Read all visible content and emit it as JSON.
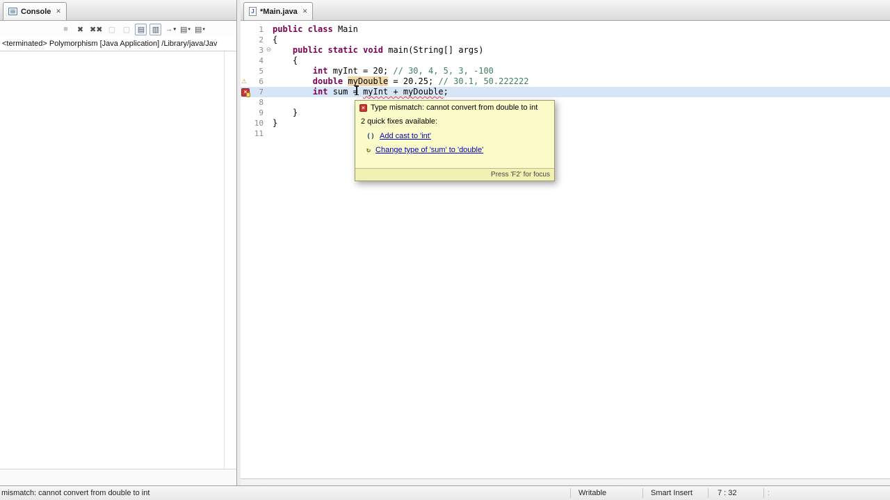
{
  "colors": {
    "keyword": "#7b0052",
    "comment": "#3f7f5f",
    "error_marker": "#cc3333",
    "link": "#0000c0",
    "tooltip_bg": "#fbfbc9",
    "current_line_highlight": "#d7e6f7",
    "occurrence_highlight": "#f1d9a9"
  },
  "console": {
    "tab_label": "Console",
    "status_line": "<terminated> Polymorphism [Java Application] /Library/java/Jav",
    "toolbar_icons": [
      {
        "name": "terminate-icon",
        "glyph": "■",
        "style": "disabled",
        "caret": false
      },
      {
        "name": "remove-launch-icon",
        "glyph": "✖",
        "style": "dark",
        "caret": false
      },
      {
        "name": "remove-all-terminated-icon",
        "glyph": "✖✖",
        "style": "dark",
        "caret": false
      },
      {
        "name": "clear-console-icon",
        "glyph": "▢",
        "style": "disabled",
        "caret": false
      },
      {
        "name": "scroll-lock-icon",
        "glyph": "▢",
        "style": "disabled",
        "caret": false
      },
      {
        "name": "show-console-on-output-icon",
        "glyph": "▤",
        "style": "framed",
        "caret": false
      },
      {
        "name": "pin-console-icon",
        "glyph": "▥",
        "style": "framed",
        "caret": false
      },
      {
        "name": "open-console-icon",
        "glyph": "→",
        "style": "green",
        "caret": true
      },
      {
        "name": "display-selected-console-icon",
        "glyph": "▤",
        "style": "dark",
        "caret": true
      },
      {
        "name": "view-menu-icon",
        "glyph": "▤",
        "style": "dark",
        "caret": true
      }
    ]
  },
  "editor": {
    "tab_label": "*Main.java",
    "tab_icon": {
      "name": "java-file-icon",
      "glyph": "J"
    },
    "code_lines": [
      {
        "n": "1",
        "segs": [
          [
            "k",
            "public"
          ],
          [
            "p",
            " "
          ],
          [
            "k",
            "class"
          ],
          [
            "p",
            " Main"
          ]
        ]
      },
      {
        "n": "2",
        "segs": [
          [
            "p",
            "{"
          ]
        ]
      },
      {
        "n": "3",
        "fold": true,
        "segs": [
          [
            "p",
            "    "
          ],
          [
            "k",
            "public"
          ],
          [
            "p",
            " "
          ],
          [
            "k",
            "static"
          ],
          [
            "p",
            " "
          ],
          [
            "k",
            "void"
          ],
          [
            "p",
            " main(String[] args)"
          ]
        ]
      },
      {
        "n": "4",
        "segs": [
          [
            "p",
            "    {"
          ]
        ]
      },
      {
        "n": "5",
        "segs": [
          [
            "p",
            "        "
          ],
          [
            "k",
            "int"
          ],
          [
            "p",
            " myInt = 20; "
          ],
          [
            "c",
            "// 30, 4, 5, 3, -100"
          ]
        ]
      },
      {
        "n": "6",
        "marker": "warning",
        "segs": [
          [
            "p",
            "        "
          ],
          [
            "k",
            "double"
          ],
          [
            "p",
            " "
          ],
          [
            "occ",
            "myDouble"
          ],
          [
            "p",
            " = 20.25; "
          ],
          [
            "c",
            "// 30.1, 50.222222"
          ]
        ]
      },
      {
        "n": "7",
        "marker": "error",
        "current": true,
        "segs": [
          [
            "p",
            "        "
          ],
          [
            "k",
            "int"
          ],
          [
            "p",
            " sum = "
          ],
          [
            "err",
            "myInt + myDouble"
          ],
          [
            "p",
            ";"
          ]
        ]
      },
      {
        "n": "8",
        "segs": []
      },
      {
        "n": "9",
        "segs": [
          [
            "p",
            "    }"
          ]
        ]
      },
      {
        "n": "10",
        "segs": [
          [
            "p",
            "}"
          ]
        ]
      },
      {
        "n": "11",
        "segs": []
      }
    ]
  },
  "popup": {
    "error_icon_glyph": "×",
    "title": "Type mismatch: cannot convert from double to int",
    "subtitle": "2 quick fixes available:",
    "fixes": [
      {
        "icon": "cast-quickfix-icon",
        "icon_class": "cast",
        "glyph": "()",
        "label": "Add cast to 'int'"
      },
      {
        "icon": "change-type-quickfix-icon",
        "icon_class": "change",
        "glyph": "↻",
        "label": "Change type of 'sum' to 'double'"
      }
    ],
    "footer": "Press 'F2' for focus"
  },
  "statusbar": {
    "message": "mismatch: cannot convert from double to int",
    "writable": "Writable",
    "insert_mode": "Smart Insert",
    "cursor_position": "7 : 32"
  }
}
